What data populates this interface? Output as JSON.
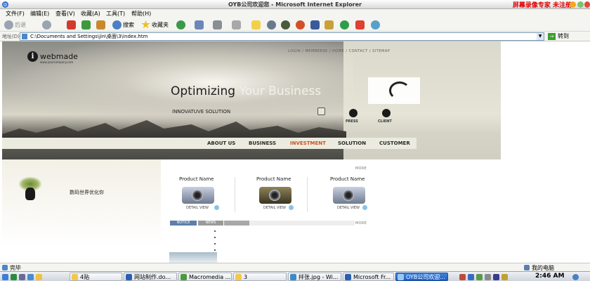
{
  "window": {
    "title": "OYB公司欢迎您 - Microsoft Internet Explorer",
    "recorder_text": "屏幕录像专家  未注册"
  },
  "menu": [
    "文件(F)",
    "编辑(E)",
    "查看(V)",
    "收藏(A)",
    "工具(T)",
    "帮助(H)"
  ],
  "toolbar": {
    "back_label": "后退",
    "search_label": "搜索",
    "favorites_label": "收藏夹"
  },
  "address": {
    "label": "地址(D)",
    "url": "C:\\Documents and Settings\\jin\\桌面\\3\\index.htm",
    "go_label": "转到"
  },
  "page": {
    "logo_text": "webmade",
    "logo_sub": "www.yourcompany.com",
    "top_links": "LOGIN / MEMBERSE / HOME / CONTACT / SITEMAP",
    "headline_a": "Optimizing ",
    "headline_b": "Your Business",
    "subheadline": "INNOVATUVE SOLUTION",
    "nav": [
      "ABOUT US",
      "BUSINESS",
      "INVESTMENT",
      "SOLUTION",
      "CUSTOMER"
    ],
    "right_labels": [
      "PRESS",
      "CLIENT"
    ],
    "slogan": "数码世界优化你",
    "more_label": "MORE",
    "products": [
      {
        "name": "Product Name",
        "detail": "DETAIL VIEW"
      },
      {
        "name": "Product Name",
        "detail": "DETAIL VIEW"
      },
      {
        "name": "Product Name",
        "detail": "DETAIL VIEW"
      }
    ],
    "tabs": [
      "NOTICE",
      "NEWS"
    ]
  },
  "status": {
    "text": "完毕",
    "zone": "我的电脑"
  },
  "taskbar": {
    "items": [
      "4贴",
      "网站制作.do...",
      "Macromedia ...",
      "3",
      "拌张.jpg - Wi...",
      "Microsoft Fr...",
      "OYB公司欢迎..."
    ],
    "clock": "2:46 AM"
  },
  "colors": {
    "accent_nav": "#c8541c",
    "recorder": "#e00000",
    "task_active": "#1f5fbf"
  }
}
